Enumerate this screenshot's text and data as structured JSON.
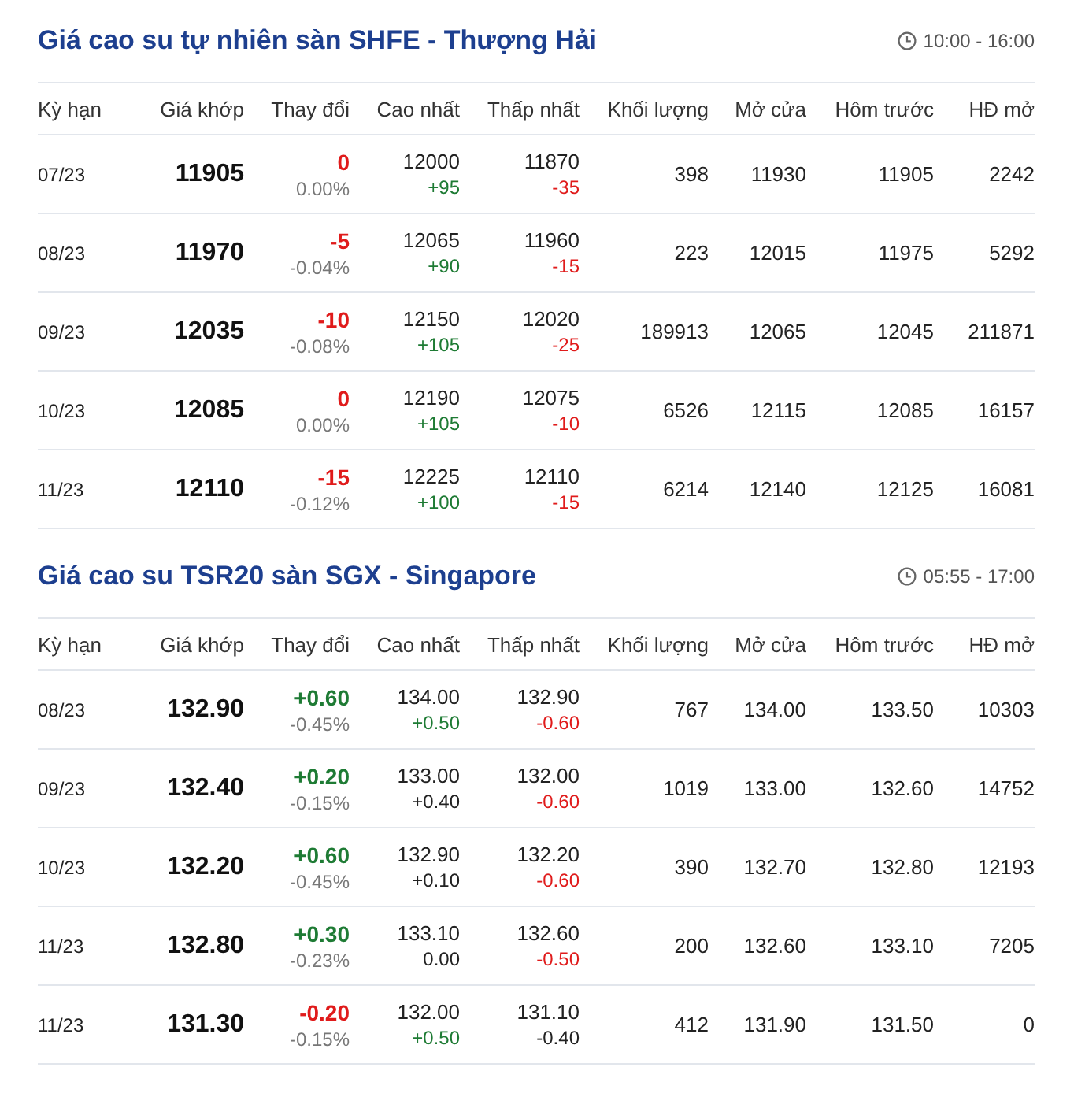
{
  "sections": [
    {
      "title": "Giá cao su tự nhiên sàn SHFE - Thượng Hải",
      "hours": "10:00 - 16:00",
      "columns": [
        "Kỳ hạn",
        "Giá khớp",
        "Thay đổi",
        "Cao nhất",
        "Thấp nhất",
        "Khối lượng",
        "Mở cửa",
        "Hôm trước",
        "HĐ mở"
      ],
      "rows": [
        {
          "term": "07/23",
          "price": "11905",
          "change": {
            "text": "0",
            "color": "#e01b1b"
          },
          "change_pct": "0.00%",
          "high": "12000",
          "high_diff": {
            "text": "+95",
            "color": "#1e7b34"
          },
          "low": "11870",
          "low_diff": {
            "text": "-35",
            "color": "#e01b1b"
          },
          "volume": "398",
          "open": "11930",
          "prev": "11905",
          "open_interest": "2242"
        },
        {
          "term": "08/23",
          "price": "11970",
          "change": {
            "text": "-5",
            "color": "#e01b1b"
          },
          "change_pct": "-0.04%",
          "high": "12065",
          "high_diff": {
            "text": "+90",
            "color": "#1e7b34"
          },
          "low": "11960",
          "low_diff": {
            "text": "-15",
            "color": "#e01b1b"
          },
          "volume": "223",
          "open": "12015",
          "prev": "11975",
          "open_interest": "5292"
        },
        {
          "term": "09/23",
          "price": "12035",
          "change": {
            "text": "-10",
            "color": "#e01b1b"
          },
          "change_pct": "-0.08%",
          "high": "12150",
          "high_diff": {
            "text": "+105",
            "color": "#1e7b34"
          },
          "low": "12020",
          "low_diff": {
            "text": "-25",
            "color": "#e01b1b"
          },
          "volume": "189913",
          "open": "12065",
          "prev": "12045",
          "open_interest": "211871"
        },
        {
          "term": "10/23",
          "price": "12085",
          "change": {
            "text": "0",
            "color": "#e01b1b"
          },
          "change_pct": "0.00%",
          "high": "12190",
          "high_diff": {
            "text": "+105",
            "color": "#1e7b34"
          },
          "low": "12075",
          "low_diff": {
            "text": "-10",
            "color": "#e01b1b"
          },
          "volume": "6526",
          "open": "12115",
          "prev": "12085",
          "open_interest": "16157"
        },
        {
          "term": "11/23",
          "price": "12110",
          "change": {
            "text": "-15",
            "color": "#e01b1b"
          },
          "change_pct": "-0.12%",
          "high": "12225",
          "high_diff": {
            "text": "+100",
            "color": "#1e7b34"
          },
          "low": "12110",
          "low_diff": {
            "text": "-15",
            "color": "#e01b1b"
          },
          "volume": "6214",
          "open": "12140",
          "prev": "12125",
          "open_interest": "16081"
        }
      ]
    },
    {
      "title": "Giá cao su TSR20 sàn SGX - Singapore",
      "hours": "05:55 - 17:00",
      "columns": [
        "Kỳ hạn",
        "Giá khớp",
        "Thay đổi",
        "Cao nhất",
        "Thấp nhất",
        "Khối lượng",
        "Mở cửa",
        "Hôm trước",
        "HĐ mở"
      ],
      "rows": [
        {
          "term": "08/23",
          "price": "132.90",
          "change": {
            "text": "+0.60",
            "color": "#1e7b34"
          },
          "change_pct": "-0.45%",
          "high": "134.00",
          "high_diff": {
            "text": "+0.50",
            "color": "#1e7b34"
          },
          "low": "132.90",
          "low_diff": {
            "text": "-0.60",
            "color": "#e01b1b"
          },
          "volume": "767",
          "open": "134.00",
          "prev": "133.50",
          "open_interest": "10303"
        },
        {
          "term": "09/23",
          "price": "132.40",
          "change": {
            "text": "+0.20",
            "color": "#1e7b34"
          },
          "change_pct": "-0.15%",
          "high": "133.00",
          "high_diff": {
            "text": "+0.40",
            "color": "#222222"
          },
          "low": "132.00",
          "low_diff": {
            "text": "-0.60",
            "color": "#e01b1b"
          },
          "volume": "1019",
          "open": "133.00",
          "prev": "132.60",
          "open_interest": "14752"
        },
        {
          "term": "10/23",
          "price": "132.20",
          "change": {
            "text": "+0.60",
            "color": "#1e7b34"
          },
          "change_pct": "-0.45%",
          "high": "132.90",
          "high_diff": {
            "text": "+0.10",
            "color": "#222222"
          },
          "low": "132.20",
          "low_diff": {
            "text": "-0.60",
            "color": "#e01b1b"
          },
          "volume": "390",
          "open": "132.70",
          "prev": "132.80",
          "open_interest": "12193"
        },
        {
          "term": "11/23",
          "price": "132.80",
          "change": {
            "text": "+0.30",
            "color": "#1e7b34"
          },
          "change_pct": "-0.23%",
          "high": "133.10",
          "high_diff": {
            "text": "0.00",
            "color": "#222222"
          },
          "low": "132.60",
          "low_diff": {
            "text": "-0.50",
            "color": "#e01b1b"
          },
          "volume": "200",
          "open": "132.60",
          "prev": "133.10",
          "open_interest": "7205"
        },
        {
          "term": "11/23",
          "price": "131.30",
          "change": {
            "text": "-0.20",
            "color": "#e01b1b"
          },
          "change_pct": "-0.15%",
          "high": "132.00",
          "high_diff": {
            "text": "+0.50",
            "color": "#1e7b34"
          },
          "low": "131.10",
          "low_diff": {
            "text": "-0.40",
            "color": "#222222"
          },
          "volume": "412",
          "open": "131.90",
          "prev": "131.50",
          "open_interest": "0"
        }
      ]
    }
  ]
}
